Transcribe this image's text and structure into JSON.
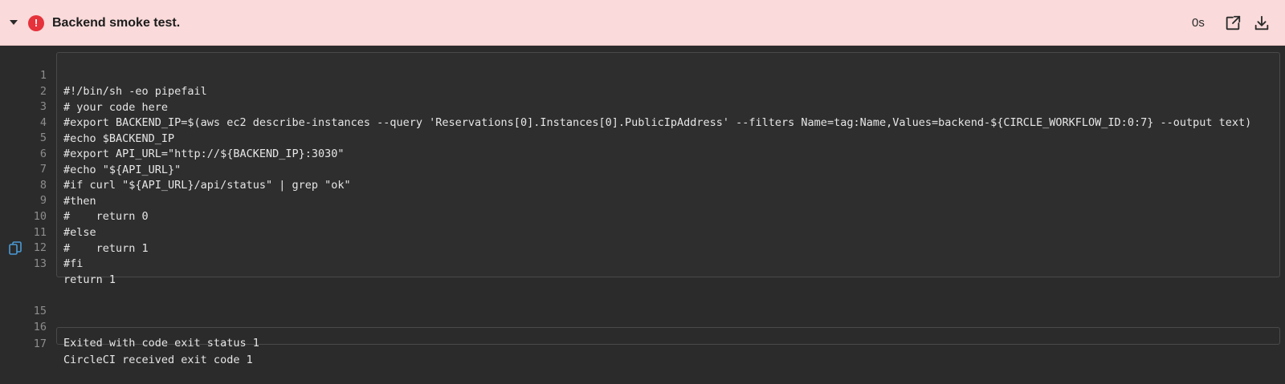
{
  "header": {
    "title": "Backend smoke test.",
    "duration": "0s",
    "status_color": "#e5323b",
    "background": "#fadada",
    "icons": [
      "caret-down-icon",
      "error-icon",
      "open-external-icon",
      "download-icon"
    ]
  },
  "log": {
    "lines": [
      {
        "n": "1",
        "text": "#!/bin/sh -eo pipefail"
      },
      {
        "n": "2",
        "text": "# your code here"
      },
      {
        "n": "3",
        "text": "#export BACKEND_IP=$(aws ec2 describe-instances --query 'Reservations[0].Instances[0].PublicIpAddress' --filters Name=tag:Name,Values=backend-${CIRCLE_WORKFLOW_ID:0:7} --output text)"
      },
      {
        "n": "4",
        "text": "#echo $BACKEND_IP"
      },
      {
        "n": "5",
        "text": "#export API_URL=\"http://${BACKEND_IP}:3030\""
      },
      {
        "n": "6",
        "text": "#echo \"${API_URL}\""
      },
      {
        "n": "7",
        "text": "#if curl \"${API_URL}/api/status\" | grep \"ok\""
      },
      {
        "n": "8",
        "text": "#then"
      },
      {
        "n": "9",
        "text": "#    return 0"
      },
      {
        "n": "10",
        "text": "#else"
      },
      {
        "n": "11",
        "text": "#    return 1"
      },
      {
        "n": "12",
        "text": "#fi"
      },
      {
        "n": "13",
        "text": "return 1"
      },
      {
        "n": "15",
        "text": ""
      },
      {
        "n": "16",
        "text": "Exited with code exit status 1"
      },
      {
        "n": "17",
        "text": "CircleCI received exit code 1"
      }
    ]
  }
}
